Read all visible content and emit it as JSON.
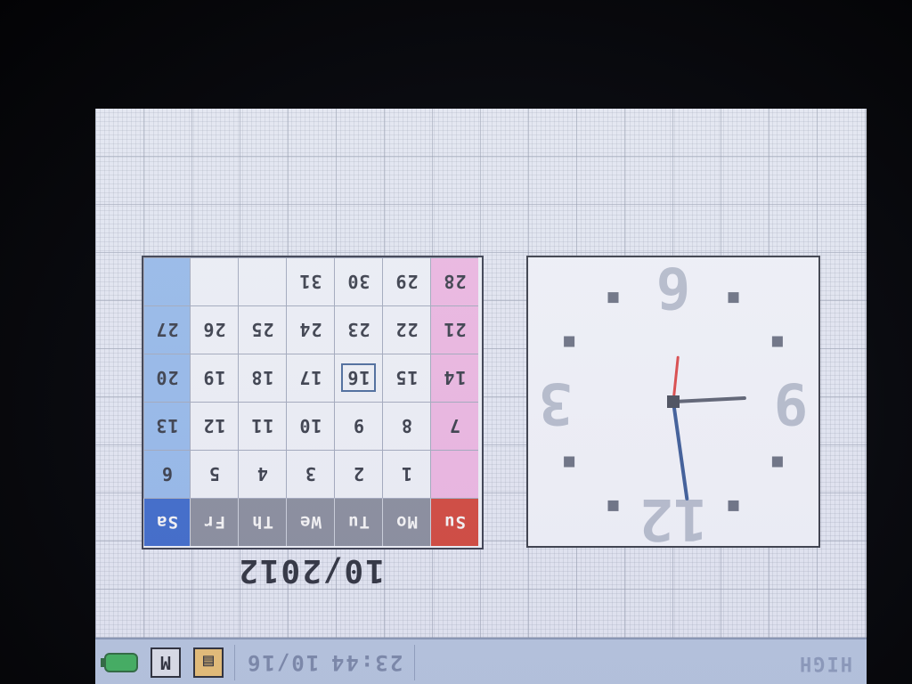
{
  "calendar": {
    "weekday_headers": [
      "Sa",
      "Fr",
      "Th",
      "We",
      "Tu",
      "Mo",
      "Su"
    ],
    "weeks": [
      [
        "",
        "",
        "",
        "31",
        "30",
        "29",
        "28"
      ],
      [
        "27",
        "26",
        "25",
        "24",
        "23",
        "22",
        "21"
      ],
      [
        "20",
        "19",
        "18",
        "17",
        "16",
        "15",
        "14"
      ],
      [
        "13",
        "12",
        "11",
        "10",
        "9",
        "8",
        "7"
      ],
      [
        "6",
        "5",
        "4",
        "3",
        "2",
        "1",
        ""
      ]
    ],
    "today": "16",
    "month_label": "10/2012"
  },
  "clock": {
    "numerals": [
      "12",
      "3",
      "6",
      "9"
    ],
    "hour": 23,
    "minute": 44,
    "second": 31
  },
  "statusbar": {
    "time": "23:44",
    "date": "10/16",
    "mode": "HIGH",
    "icons": [
      "battery-icon",
      "memory-card-icon",
      "tray-icon"
    ]
  },
  "colors": {
    "saturday": "#2f5fc4",
    "sunday": "#cc3a2e",
    "lcd_background": "#dfe3ef"
  }
}
